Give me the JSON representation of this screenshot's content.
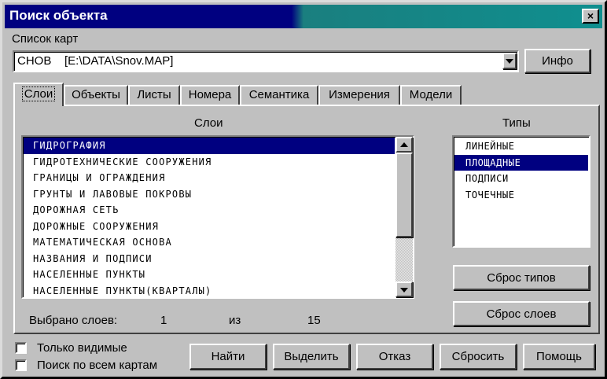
{
  "window": {
    "title": "Поиск объекта",
    "close_label": "×"
  },
  "maps": {
    "label": "Список карт",
    "selected": "СНОВ    [E:\\DATA\\Snov.MAP]",
    "info_button": "Инфо"
  },
  "tabs": [
    {
      "label": "Слои",
      "active": true
    },
    {
      "label": "Объекты"
    },
    {
      "label": "Листы"
    },
    {
      "label": "Номера"
    },
    {
      "label": "Семантика"
    },
    {
      "label": "Измерения"
    },
    {
      "label": "Модели"
    }
  ],
  "layers": {
    "header": "Слои",
    "items": [
      "ГИДРОГРАФИЯ",
      "ГИДРОТЕХНИЧЕСКИЕ СООРУЖЕНИЯ",
      "ГРАНИЦЫ И ОГРАЖДЕНИЯ",
      "ГРУНТЫ И ЛАВОВЫЕ ПОКРОВЫ",
      "ДОРОЖНАЯ СЕТЬ",
      "ДОРОЖНЫЕ СООРУЖЕНИЯ",
      "МАТЕМАТИЧЕСКАЯ ОСНОВА",
      "НАЗВАНИЯ И ПОДПИСИ",
      "НАСЕЛЕННЫЕ ПУНКТЫ",
      "НАСЕЛЕННЫЕ ПУНКТЫ(КВАРТАЛЫ)"
    ],
    "selected_index": 0,
    "status_label": "Выбрано слоев:",
    "selected_count": "1",
    "of_label": "из",
    "total_count": "15"
  },
  "types": {
    "header": "Типы",
    "items": [
      "ЛИНЕЙНЫЕ",
      "ПЛОЩАДНЫЕ",
      "ПОДПИСИ",
      "ТОЧЕЧНЫЕ"
    ],
    "selected_index": 1,
    "reset_types_button": "Сброс типов",
    "reset_layers_button": "Сброс слоев"
  },
  "options": {
    "only_visible": "Только видимые",
    "search_all_maps": "Поиск по всем картам"
  },
  "actions": {
    "find": "Найти",
    "select": "Выделить",
    "cancel": "Отказ",
    "reset": "Сбросить",
    "help": "Помощь"
  },
  "colors": {
    "selection": "#000080",
    "face": "#c0c0c0",
    "title_teal": "#0f8f8f"
  }
}
